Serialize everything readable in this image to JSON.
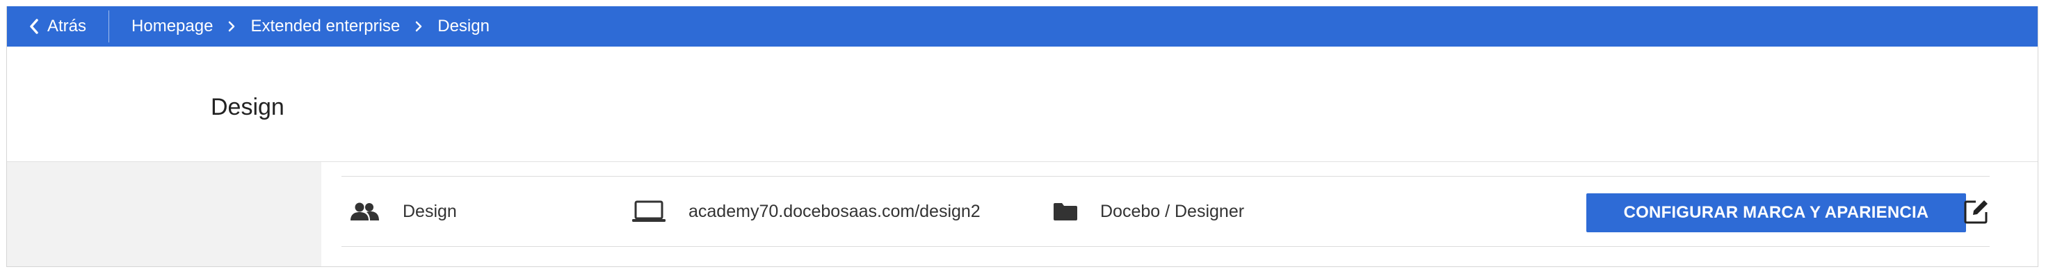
{
  "topbar": {
    "back_label": "Atrás",
    "breadcrumb": [
      "Homepage",
      "Extended enterprise",
      "Design"
    ],
    "bg_color": "#2e6bd6"
  },
  "page": {
    "title": "Design"
  },
  "row": {
    "group_icon": "users-icon",
    "group_name": "Design",
    "url_icon": "laptop-icon",
    "url": "academy70.docebosaas.com/design2",
    "folder_icon": "folder-icon",
    "folder_path": "Docebo / Designer",
    "action_label": "CONFIGURAR MARCA Y APARIENCIA",
    "edit_icon": "edit-icon",
    "action_color": "#2e6bd6"
  }
}
